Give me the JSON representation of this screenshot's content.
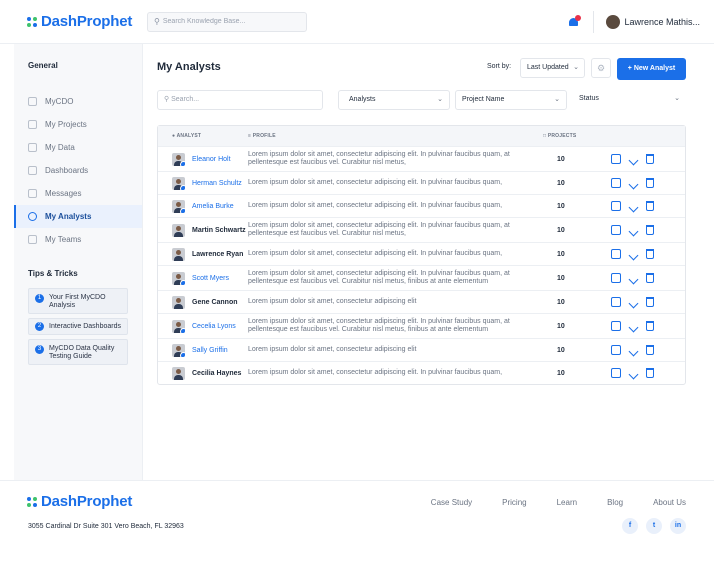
{
  "brand": {
    "name": "DashProphet",
    "primary": "#1b6fe8",
    "accent": "#3ec36d"
  },
  "header": {
    "search_placeholder": "Search Knowledge Base...",
    "user_name": "Lawrence Mathis..."
  },
  "sidebar": {
    "section_general": "General",
    "items": [
      {
        "label": "MyCDO",
        "icon": "home-icon"
      },
      {
        "label": "My Projects",
        "icon": "document-icon"
      },
      {
        "label": "My Data",
        "icon": "data-icon"
      },
      {
        "label": "Dashboards",
        "icon": "dashboard-icon"
      },
      {
        "label": "Messages",
        "icon": "messages-icon"
      },
      {
        "label": "My Analysts",
        "icon": "analysts-icon"
      },
      {
        "label": "My Teams",
        "icon": "teams-icon"
      }
    ],
    "section_tips": "Tips & Tricks",
    "tips": [
      {
        "num": "1",
        "text": "Your First MyCDO Analysis"
      },
      {
        "num": "2",
        "text": "Interactive Dashboards"
      },
      {
        "num": "3",
        "text": "MyCDO Data Quality Testing Guide"
      }
    ]
  },
  "main": {
    "title": "My Analysts",
    "sort_label": "Sort by:",
    "sort_value": "Last Updated",
    "new_button": "+ New Analyst",
    "filters": {
      "search_placeholder": "Search...",
      "analysts": "Analysts",
      "project": "Project Name",
      "status": "Status"
    },
    "columns": {
      "analyst": "ANALYST",
      "profile": "PROFILE",
      "projects": "PROJECTS"
    },
    "rows": [
      {
        "name": "Eleanor Holt",
        "link": true,
        "badge": true,
        "profile": "Lorem ipsum dolor sit amet, consectetur adipiscing elit. In pulvinar faucibus quam, at pellentesque est faucibus vel. Curabitur nisl metus,",
        "projects": "10"
      },
      {
        "name": "Herman Schultz",
        "link": true,
        "badge": true,
        "profile": "Lorem ipsum dolor sit amet, consectetur adipiscing elit. In pulvinar faucibus quam,",
        "projects": "10"
      },
      {
        "name": "Amelia Burke",
        "link": true,
        "badge": true,
        "profile": "Lorem ipsum dolor sit amet, consectetur adipiscing elit. In pulvinar faucibus quam,",
        "projects": "10"
      },
      {
        "name": "Martin Schwartz",
        "link": false,
        "badge": false,
        "profile": "Lorem ipsum dolor sit amet, consectetur adipiscing elit. In pulvinar faucibus quam, at pellentesque est faucibus vel. Curabitur nisl metus,",
        "projects": "10"
      },
      {
        "name": "Lawrence Ryan",
        "link": false,
        "badge": false,
        "profile": "Lorem ipsum dolor sit amet, consectetur adipiscing elit. In pulvinar faucibus quam,",
        "projects": "10"
      },
      {
        "name": "Scott Myers",
        "link": true,
        "badge": true,
        "profile": "Lorem ipsum dolor sit amet, consectetur adipiscing elit. In pulvinar faucibus quam, at pellentesque est faucibus vel. Curabitur nisl metus, finibus at ante elementum",
        "projects": "10"
      },
      {
        "name": "Gene Cannon",
        "link": false,
        "badge": false,
        "profile": "Lorem ipsum dolor sit amet, consectetur adipiscing elit",
        "projects": "10"
      },
      {
        "name": "Cecelia Lyons",
        "link": true,
        "badge": true,
        "profile": "Lorem ipsum dolor sit amet, consectetur adipiscing elit. In pulvinar faucibus quam, at pellentesque est faucibus vel. Curabitur nisl metus, finibus at ante elementum",
        "projects": "10"
      },
      {
        "name": "Sally Griffin",
        "link": true,
        "badge": true,
        "profile": "Lorem ipsum dolor sit amet, consectetur adipiscing elit",
        "projects": "10"
      },
      {
        "name": "Cecilia Haynes",
        "link": false,
        "badge": false,
        "profile": "Lorem ipsum dolor sit amet, consectetur adipiscing elit. In pulvinar faucibus quam,",
        "projects": "10"
      }
    ]
  },
  "footer": {
    "address": "3055 Cardinal Dr Suite 301 Vero Beach, FL 32963",
    "links": [
      "Case Study",
      "Pricing",
      "Learn",
      "Blog",
      "About Us"
    ],
    "socials": [
      {
        "label": "f",
        "icon": "facebook-icon"
      },
      {
        "label": "t",
        "icon": "twitter-icon"
      },
      {
        "label": "in",
        "icon": "linkedin-icon"
      }
    ]
  }
}
